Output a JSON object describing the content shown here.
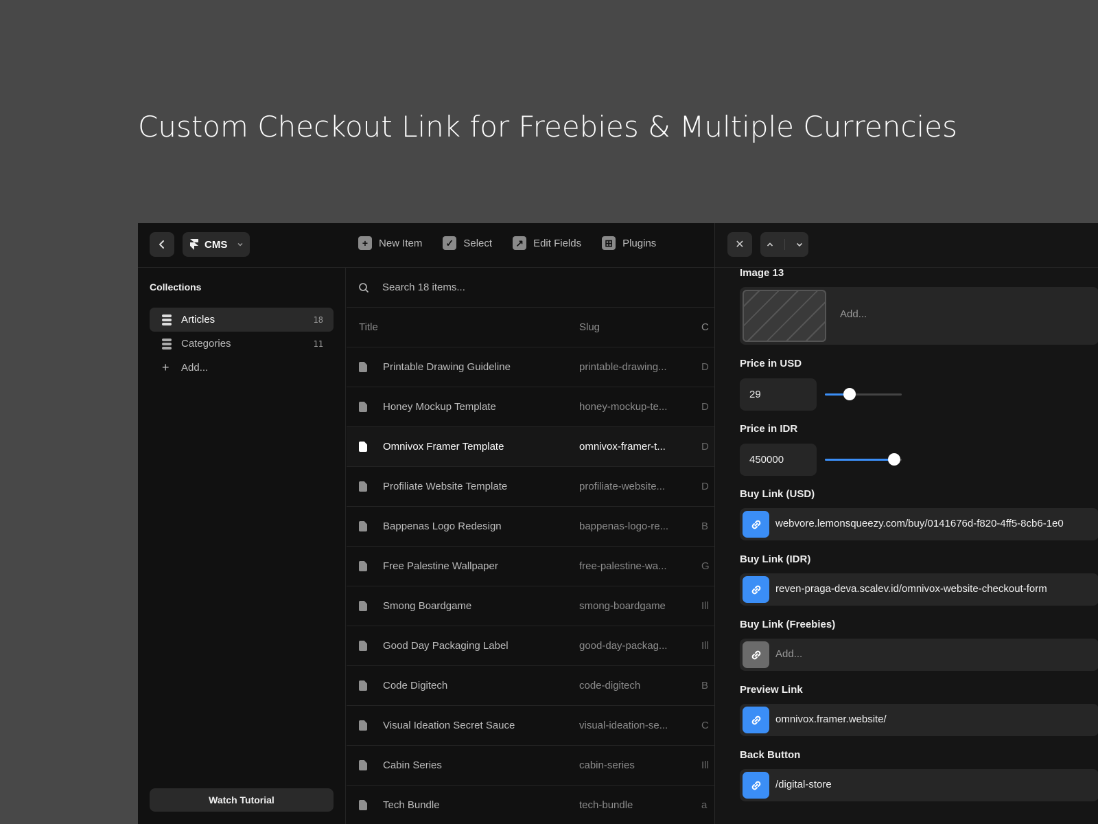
{
  "headline": "Custom Checkout Link for Freebies & Multiple Currencies",
  "topbar": {
    "cms_label": "CMS",
    "tools": [
      {
        "label": "New Item",
        "icon": "plus-icon"
      },
      {
        "label": "Select",
        "icon": "check-icon"
      },
      {
        "label": "Edit Fields",
        "icon": "arrow-up-right-icon"
      },
      {
        "label": "Plugins",
        "icon": "plugin-icon"
      }
    ]
  },
  "sidebar": {
    "title": "Collections",
    "items": [
      {
        "label": "Articles",
        "count": "18"
      },
      {
        "label": "Categories",
        "count": "11"
      }
    ],
    "add_label": "Add...",
    "watch_label": "Watch Tutorial"
  },
  "list": {
    "search_placeholder": "Search 18 items...",
    "columns": {
      "title": "Title",
      "slug": "Slug",
      "category": "C"
    },
    "rows": [
      {
        "title": "Printable Drawing Guideline",
        "slug": "printable-drawing...",
        "cat": "D"
      },
      {
        "title": "Honey Mockup Template",
        "slug": "honey-mockup-te...",
        "cat": "D"
      },
      {
        "title": "Omnivox Framer Template",
        "slug": "omnivox-framer-t...",
        "cat": "D"
      },
      {
        "title": "Profiliate Website Template",
        "slug": "profiliate-website...",
        "cat": "D"
      },
      {
        "title": "Bappenas Logo Redesign",
        "slug": "bappenas-logo-re...",
        "cat": "B"
      },
      {
        "title": "Free Palestine Wallpaper",
        "slug": "free-palestine-wa...",
        "cat": "G"
      },
      {
        "title": "Smong Boardgame",
        "slug": "smong-boardgame",
        "cat": "Ill"
      },
      {
        "title": "Good Day Packaging Label",
        "slug": "good-day-packag...",
        "cat": "Ill"
      },
      {
        "title": "Code Digitech",
        "slug": "code-digitech",
        "cat": "B"
      },
      {
        "title": "Visual Ideation Secret Sauce",
        "slug": "visual-ideation-se...",
        "cat": "C"
      },
      {
        "title": "Cabin Series",
        "slug": "cabin-series",
        "cat": "Ill"
      },
      {
        "title": "Tech Bundle",
        "slug": "tech-bundle",
        "cat": "a"
      }
    ]
  },
  "panel": {
    "image_label": "Image 13",
    "image_add": "Add...",
    "price_usd_label": "Price in USD",
    "price_usd": "29",
    "price_usd_level": 0.32,
    "price_idr_label": "Price in IDR",
    "price_idr": "450000",
    "price_idr_level": 0.9,
    "buy_usd_label": "Buy Link (USD)",
    "buy_usd": "webvore.lemonsqueezy.com/buy/0141676d-f820-4ff5-8cb6-1e0",
    "buy_idr_label": "Buy Link (IDR)",
    "buy_idr": "reven-praga-deva.scalev.id/omnivox-website-checkout-form",
    "buy_free_label": "Buy Link (Freebies)",
    "buy_free_placeholder": "Add...",
    "preview_label": "Preview Link",
    "preview": "omnivox.framer.website/",
    "back_label": "Back Button",
    "back": "/digital-store"
  }
}
